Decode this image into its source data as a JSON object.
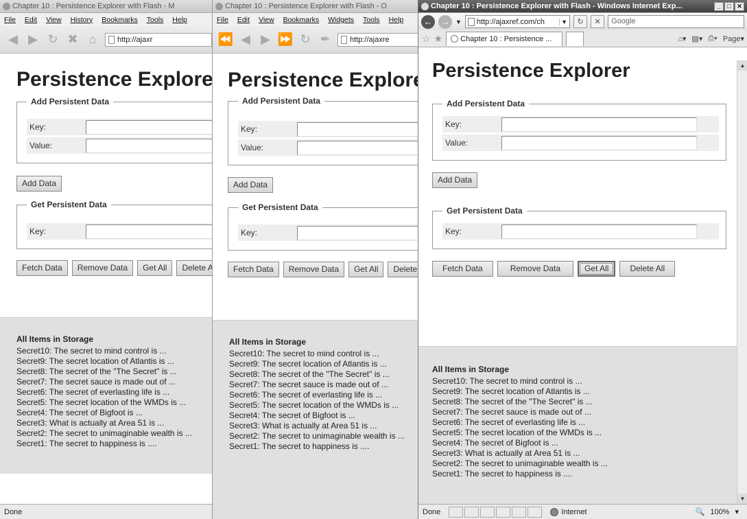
{
  "common": {
    "page_title": "Persistence Explorer",
    "add_legend": "Add Persistent Data",
    "key_label": "Key:",
    "value_label": "Value:",
    "add_button": "Add Data",
    "get_legend": "Get Persistent Data",
    "fetch_button": "Fetch Data",
    "remove_button": "Remove Data",
    "getall_button": "Get All",
    "deleteall_button": "Delete All",
    "storage_heading": "All Items in Storage",
    "items": [
      "Secret10: The secret to mind control is ...",
      "Secret9: The secret location of Atlantis is ...",
      "Secret8: The secret of the \"The Secret\" is ...",
      "Secret7: The secret sauce is made out of ...",
      "Secret6: The secret of everlasting life is ...",
      "Secret5: The secret location of the WMDs is ...",
      "Secret4: The secret of Bigfoot is ...",
      "Secret3: What is actually at Area 51 is ...",
      "Secret2: The secret to unimaginable wealth is ...",
      "Secret1: The secret to happiness is ...."
    ]
  },
  "window1": {
    "title": "Chapter 10 : Persistence Explorer with Flash - M",
    "menu": [
      "File",
      "Edit",
      "View",
      "History",
      "Bookmarks",
      "Tools",
      "Help"
    ],
    "url": "http://ajaxr",
    "status": "Done"
  },
  "window2": {
    "title": "Chapter 10 : Persistence Explorer with Flash - O",
    "menu": [
      "File",
      "Edit",
      "View",
      "Bookmarks",
      "Widgets",
      "Tools",
      "Help"
    ],
    "url": "http://ajaxre"
  },
  "window3": {
    "title": "Chapter 10 : Persistence Explorer with Flash - Windows Internet Exp...",
    "url": "http://ajaxref.com/ch",
    "search_placeholder": "Google",
    "tab_label": "Chapter 10 : Persistence ...",
    "page_menu": "Page",
    "status": "Done",
    "zone": "Internet",
    "zoom": "100%"
  }
}
